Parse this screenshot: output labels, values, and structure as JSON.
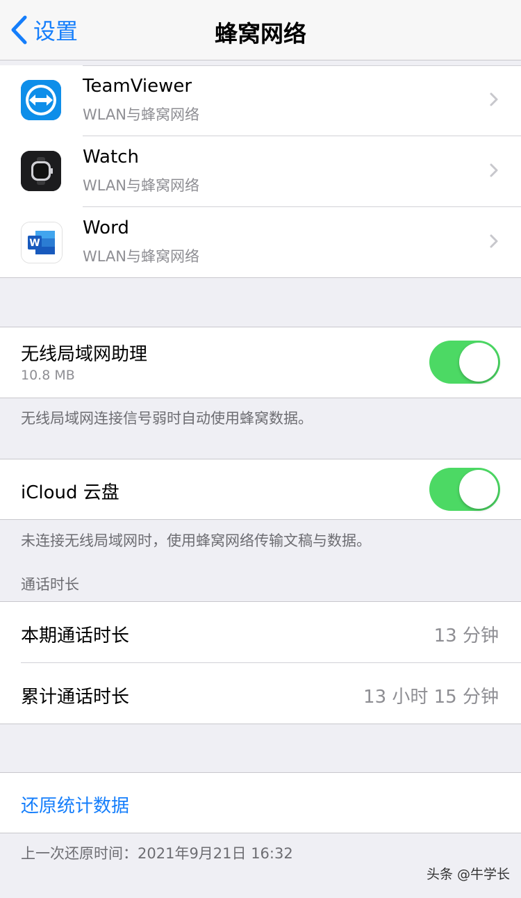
{
  "nav": {
    "back_label": "设置",
    "title": "蜂窝网络"
  },
  "apps": [
    {
      "name": "TeamViewer",
      "subtitle": "WLAN与蜂窝网络",
      "icon": "teamviewer-icon"
    },
    {
      "name": "Watch",
      "subtitle": "WLAN与蜂窝网络",
      "icon": "watch-icon"
    },
    {
      "name": "Word",
      "subtitle": "WLAN与蜂窝网络",
      "icon": "word-icon"
    }
  ],
  "wifi_assist": {
    "title": "无线局域网助理",
    "usage": "10.8 MB",
    "enabled": true,
    "footnote": "无线局域网连接信号弱时自动使用蜂窝数据。"
  },
  "icloud_drive": {
    "title": "iCloud 云盘",
    "enabled": true,
    "footnote": "未连接无线局域网时，使用蜂窝网络传输文稿与数据。"
  },
  "call_time": {
    "header": "通话时长",
    "current_label": "本期通话时长",
    "current_value": "13 分钟",
    "lifetime_label": "累计通话时长",
    "lifetime_value": "13 小时 15 分钟"
  },
  "reset": {
    "label": "还原统计数据",
    "last_reset": "上一次还原时间：2021年9月21日 16:32"
  },
  "watermark": "头条 @牛学长",
  "colors": {
    "accent": "#157efb",
    "toggle_on": "#4cd964",
    "background": "#efeff4"
  }
}
